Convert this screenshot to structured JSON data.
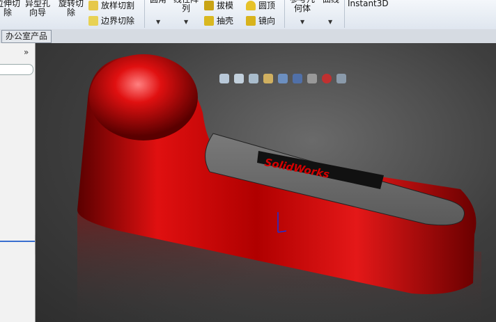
{
  "ribbon": {
    "extrude_cut": "拉伸切\n除",
    "hole_wizard": "异型孔\n向导",
    "revolve_cut": "旋转切\n除",
    "swept_cut": "放样切割",
    "boundary_cut": "边界切除",
    "fillet": "圆角",
    "linear_pattern": "线性阵\n列",
    "draft": "拔模",
    "shell": "抽壳",
    "dome": "圆顶",
    "mirror": "镜向",
    "reference_geometry": "参考几\n何体",
    "curves": "曲线",
    "instant3d": "Instant3D"
  },
  "tabs": {
    "active": "办公室产品"
  },
  "viewport": {
    "logo_text": "SolidWorks"
  },
  "colors": {
    "part": "#c40000",
    "background": "#3e3e3e",
    "accent": "#3a6fd0"
  }
}
